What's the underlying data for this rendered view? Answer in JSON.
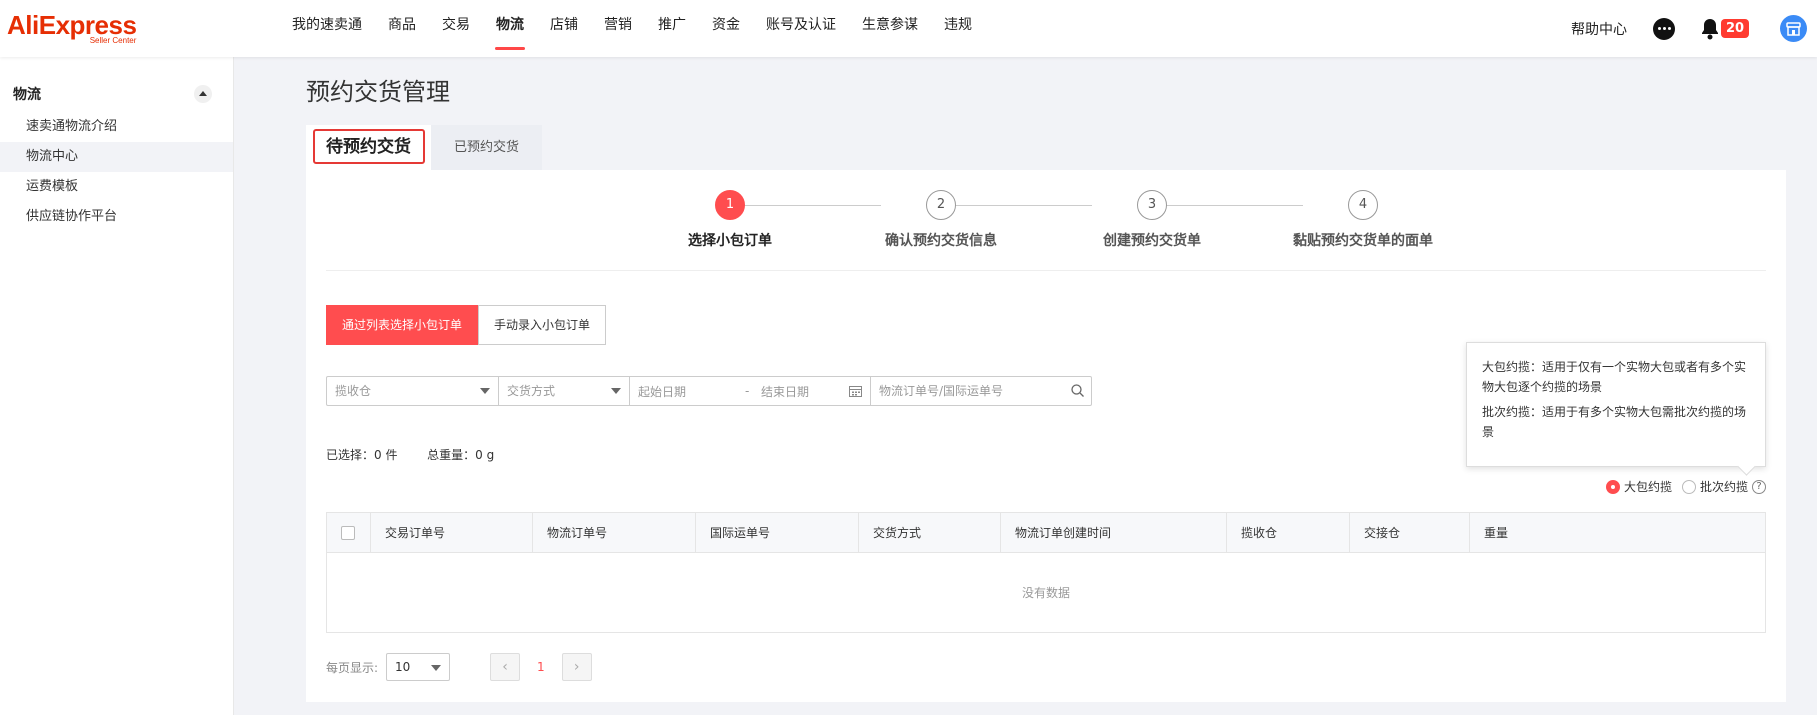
{
  "header": {
    "brand": "AliExpress",
    "brand_sub": "Seller Center",
    "nav": [
      "我的速卖通",
      "商品",
      "交易",
      "物流",
      "店铺",
      "营销",
      "推广",
      "资金",
      "账号及认证",
      "生意参谋",
      "违规"
    ],
    "active_nav": "物流",
    "help": "帮助中心",
    "notification_count": "20"
  },
  "sidebar": {
    "section": "物流",
    "items": [
      "速卖通物流介绍",
      "物流中心",
      "运费模板",
      "供应链协作平台"
    ],
    "active": "物流中心"
  },
  "page": {
    "title": "预约交货管理",
    "tabs": [
      "待预约交货",
      "已预约交货"
    ]
  },
  "steps": [
    {
      "num": "1",
      "label": "选择小包订单"
    },
    {
      "num": "2",
      "label": "确认预约交货信息"
    },
    {
      "num": "3",
      "label": "创建预约交货单"
    },
    {
      "num": "4",
      "label": "黏贴预约交货单的面单"
    }
  ],
  "modes": [
    "通过列表选择小包订单",
    "手动录入小包订单"
  ],
  "filters": {
    "warehouse_placeholder": "揽收仓",
    "delivery_placeholder": "交货方式",
    "start_date": "起始日期",
    "date_sep": "-",
    "end_date": "结束日期",
    "search_placeholder": "物流订单号/国际运单号"
  },
  "selection": {
    "selected_label": "已选择：",
    "selected_value": "0 件",
    "weight_label": "总重量：",
    "weight_value": "0 g"
  },
  "tooltip": {
    "line1": "大包约揽：适用于仅有一个实物大包或者有多个实物大包逐个约揽的场景",
    "line2": "批次约揽：适用于有多个实物大包需批次约揽的场景"
  },
  "radios": [
    "大包约揽",
    "批次约揽"
  ],
  "table": {
    "columns": [
      "交易订单号",
      "物流订单号",
      "国际运单号",
      "交货方式",
      "物流订单创建时间",
      "揽收仓",
      "交接仓",
      "重量"
    ],
    "empty": "没有数据"
  },
  "pager": {
    "per_page_label": "每页显示:",
    "per_page": "10",
    "current": "1"
  },
  "colors": {
    "accent": "#ff4d4f",
    "brand": "#e62e04"
  }
}
